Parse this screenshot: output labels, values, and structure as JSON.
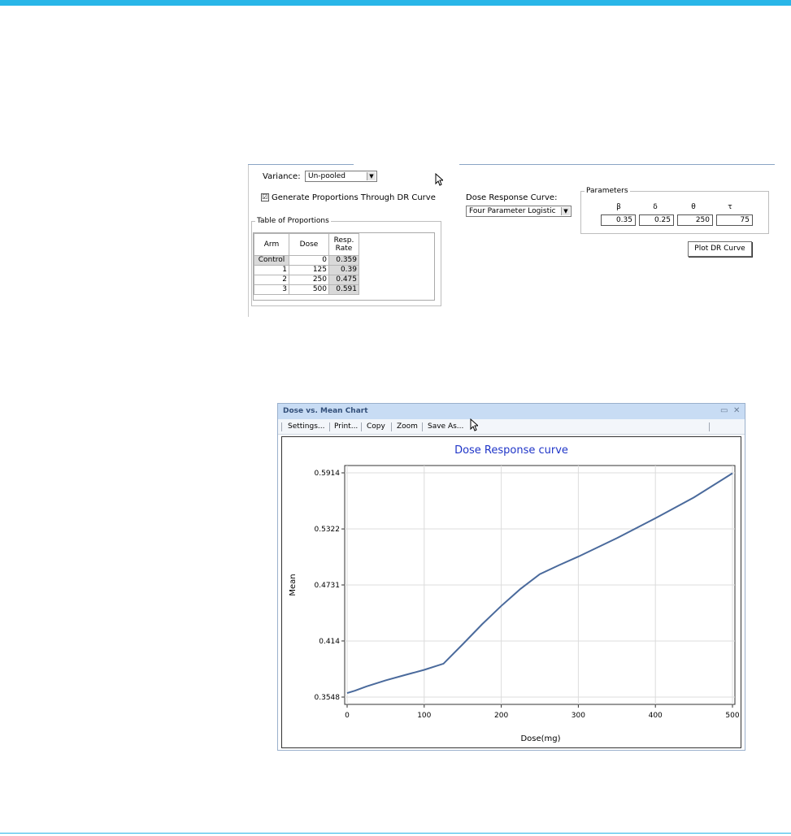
{
  "settings": {
    "variance_label": "Variance:",
    "variance_value": "Un-pooled",
    "generate_label": "Generate Proportions Through DR Curve",
    "generate_checked": "☑",
    "table_group_label": "Table of Proportions",
    "columns": [
      "Arm",
      "Dose",
      "Resp. Rate"
    ],
    "rows": [
      {
        "arm": "Control",
        "dose": "0",
        "rate": "0.359"
      },
      {
        "arm": "1",
        "dose": "125",
        "rate": "0.39"
      },
      {
        "arm": "2",
        "dose": "250",
        "rate": "0.475"
      },
      {
        "arm": "3",
        "dose": "500",
        "rate": "0.591"
      }
    ],
    "dr_curve_label": "Dose Response Curve:",
    "dr_curve_value": "Four Parameter Logistic",
    "params_group_label": "Parameters",
    "params": [
      {
        "symbol": "β",
        "value": "0.35"
      },
      {
        "symbol": "δ",
        "value": "0.25"
      },
      {
        "symbol": "θ",
        "value": "250"
      },
      {
        "symbol": "τ",
        "value": "75"
      }
    ],
    "plot_button": "Plot DR Curve"
  },
  "chart_window": {
    "title": "Dose vs. Mean Chart",
    "toolbar": [
      "Settings...",
      "Print...",
      "Copy",
      "Zoom",
      "Save As..."
    ]
  },
  "chart_data": {
    "type": "line",
    "title": "Dose Response curve",
    "xlabel": "Dose(mg)",
    "ylabel": "Mean",
    "xlim": [
      0,
      500
    ],
    "ylim": [
      0.3548,
      0.5914
    ],
    "xticks": [
      0,
      100,
      200,
      300,
      400,
      500
    ],
    "yticks": [
      "0.3548",
      "0.414",
      "0.4731",
      "0.5322",
      "0.5914"
    ],
    "grid": true,
    "series": [
      {
        "color": "#4a6a9c",
        "x": [
          0,
          10,
          25,
          50,
          75,
          100,
          115,
          125,
          150,
          175,
          200,
          225,
          250,
          275,
          300,
          350,
          400,
          450,
          500
        ],
        "y": [
          0.359,
          0.3615,
          0.366,
          0.3725,
          0.378,
          0.3835,
          0.3875,
          0.39,
          0.4105,
          0.4315,
          0.451,
          0.469,
          0.4845,
          0.494,
          0.503,
          0.5225,
          0.5435,
          0.5655,
          0.591
        ]
      }
    ]
  }
}
